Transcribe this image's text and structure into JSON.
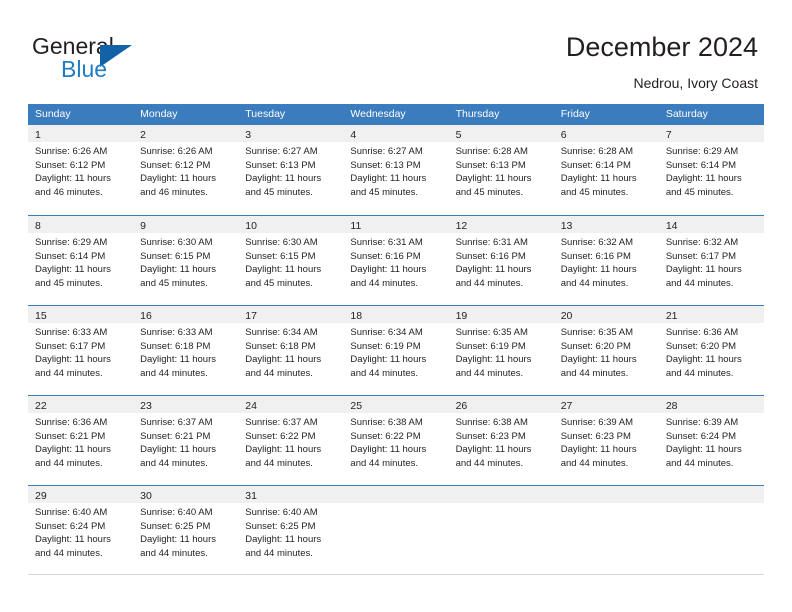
{
  "brand": {
    "line1": "General",
    "line2": "Blue",
    "icon": "triangle-flag-icon",
    "color_dark": "#231f20",
    "color_blue": "#1f7dc0",
    "flag_color": "#1362a8"
  },
  "header": {
    "title": "December 2024",
    "subtitle": "Nedrou, Ivory Coast"
  },
  "theme": {
    "header_bg": "#3b7cbe",
    "header_text": "#ffffff",
    "day_strip_bg": "#f0f0f0",
    "text": "#231f20"
  },
  "calendar": {
    "weekday_headers": [
      "Sunday",
      "Monday",
      "Tuesday",
      "Wednesday",
      "Thursday",
      "Friday",
      "Saturday"
    ],
    "weeks": [
      [
        {
          "day": "1",
          "sunrise": "Sunrise: 6:26 AM",
          "sunset": "Sunset: 6:12 PM",
          "daylight1": "Daylight: 11 hours",
          "daylight2": "and 46 minutes."
        },
        {
          "day": "2",
          "sunrise": "Sunrise: 6:26 AM",
          "sunset": "Sunset: 6:12 PM",
          "daylight1": "Daylight: 11 hours",
          "daylight2": "and 46 minutes."
        },
        {
          "day": "3",
          "sunrise": "Sunrise: 6:27 AM",
          "sunset": "Sunset: 6:13 PM",
          "daylight1": "Daylight: 11 hours",
          "daylight2": "and 45 minutes."
        },
        {
          "day": "4",
          "sunrise": "Sunrise: 6:27 AM",
          "sunset": "Sunset: 6:13 PM",
          "daylight1": "Daylight: 11 hours",
          "daylight2": "and 45 minutes."
        },
        {
          "day": "5",
          "sunrise": "Sunrise: 6:28 AM",
          "sunset": "Sunset: 6:13 PM",
          "daylight1": "Daylight: 11 hours",
          "daylight2": "and 45 minutes."
        },
        {
          "day": "6",
          "sunrise": "Sunrise: 6:28 AM",
          "sunset": "Sunset: 6:14 PM",
          "daylight1": "Daylight: 11 hours",
          "daylight2": "and 45 minutes."
        },
        {
          "day": "7",
          "sunrise": "Sunrise: 6:29 AM",
          "sunset": "Sunset: 6:14 PM",
          "daylight1": "Daylight: 11 hours",
          "daylight2": "and 45 minutes."
        }
      ],
      [
        {
          "day": "8",
          "sunrise": "Sunrise: 6:29 AM",
          "sunset": "Sunset: 6:14 PM",
          "daylight1": "Daylight: 11 hours",
          "daylight2": "and 45 minutes."
        },
        {
          "day": "9",
          "sunrise": "Sunrise: 6:30 AM",
          "sunset": "Sunset: 6:15 PM",
          "daylight1": "Daylight: 11 hours",
          "daylight2": "and 45 minutes."
        },
        {
          "day": "10",
          "sunrise": "Sunrise: 6:30 AM",
          "sunset": "Sunset: 6:15 PM",
          "daylight1": "Daylight: 11 hours",
          "daylight2": "and 45 minutes."
        },
        {
          "day": "11",
          "sunrise": "Sunrise: 6:31 AM",
          "sunset": "Sunset: 6:16 PM",
          "daylight1": "Daylight: 11 hours",
          "daylight2": "and 44 minutes."
        },
        {
          "day": "12",
          "sunrise": "Sunrise: 6:31 AM",
          "sunset": "Sunset: 6:16 PM",
          "daylight1": "Daylight: 11 hours",
          "daylight2": "and 44 minutes."
        },
        {
          "day": "13",
          "sunrise": "Sunrise: 6:32 AM",
          "sunset": "Sunset: 6:16 PM",
          "daylight1": "Daylight: 11 hours",
          "daylight2": "and 44 minutes."
        },
        {
          "day": "14",
          "sunrise": "Sunrise: 6:32 AM",
          "sunset": "Sunset: 6:17 PM",
          "daylight1": "Daylight: 11 hours",
          "daylight2": "and 44 minutes."
        }
      ],
      [
        {
          "day": "15",
          "sunrise": "Sunrise: 6:33 AM",
          "sunset": "Sunset: 6:17 PM",
          "daylight1": "Daylight: 11 hours",
          "daylight2": "and 44 minutes."
        },
        {
          "day": "16",
          "sunrise": "Sunrise: 6:33 AM",
          "sunset": "Sunset: 6:18 PM",
          "daylight1": "Daylight: 11 hours",
          "daylight2": "and 44 minutes."
        },
        {
          "day": "17",
          "sunrise": "Sunrise: 6:34 AM",
          "sunset": "Sunset: 6:18 PM",
          "daylight1": "Daylight: 11 hours",
          "daylight2": "and 44 minutes."
        },
        {
          "day": "18",
          "sunrise": "Sunrise: 6:34 AM",
          "sunset": "Sunset: 6:19 PM",
          "daylight1": "Daylight: 11 hours",
          "daylight2": "and 44 minutes."
        },
        {
          "day": "19",
          "sunrise": "Sunrise: 6:35 AM",
          "sunset": "Sunset: 6:19 PM",
          "daylight1": "Daylight: 11 hours",
          "daylight2": "and 44 minutes."
        },
        {
          "day": "20",
          "sunrise": "Sunrise: 6:35 AM",
          "sunset": "Sunset: 6:20 PM",
          "daylight1": "Daylight: 11 hours",
          "daylight2": "and 44 minutes."
        },
        {
          "day": "21",
          "sunrise": "Sunrise: 6:36 AM",
          "sunset": "Sunset: 6:20 PM",
          "daylight1": "Daylight: 11 hours",
          "daylight2": "and 44 minutes."
        }
      ],
      [
        {
          "day": "22",
          "sunrise": "Sunrise: 6:36 AM",
          "sunset": "Sunset: 6:21 PM",
          "daylight1": "Daylight: 11 hours",
          "daylight2": "and 44 minutes."
        },
        {
          "day": "23",
          "sunrise": "Sunrise: 6:37 AM",
          "sunset": "Sunset: 6:21 PM",
          "daylight1": "Daylight: 11 hours",
          "daylight2": "and 44 minutes."
        },
        {
          "day": "24",
          "sunrise": "Sunrise: 6:37 AM",
          "sunset": "Sunset: 6:22 PM",
          "daylight1": "Daylight: 11 hours",
          "daylight2": "and 44 minutes."
        },
        {
          "day": "25",
          "sunrise": "Sunrise: 6:38 AM",
          "sunset": "Sunset: 6:22 PM",
          "daylight1": "Daylight: 11 hours",
          "daylight2": "and 44 minutes."
        },
        {
          "day": "26",
          "sunrise": "Sunrise: 6:38 AM",
          "sunset": "Sunset: 6:23 PM",
          "daylight1": "Daylight: 11 hours",
          "daylight2": "and 44 minutes."
        },
        {
          "day": "27",
          "sunrise": "Sunrise: 6:39 AM",
          "sunset": "Sunset: 6:23 PM",
          "daylight1": "Daylight: 11 hours",
          "daylight2": "and 44 minutes."
        },
        {
          "day": "28",
          "sunrise": "Sunrise: 6:39 AM",
          "sunset": "Sunset: 6:24 PM",
          "daylight1": "Daylight: 11 hours",
          "daylight2": "and 44 minutes."
        }
      ],
      [
        {
          "day": "29",
          "sunrise": "Sunrise: 6:40 AM",
          "sunset": "Sunset: 6:24 PM",
          "daylight1": "Daylight: 11 hours",
          "daylight2": "and 44 minutes."
        },
        {
          "day": "30",
          "sunrise": "Sunrise: 6:40 AM",
          "sunset": "Sunset: 6:25 PM",
          "daylight1": "Daylight: 11 hours",
          "daylight2": "and 44 minutes."
        },
        {
          "day": "31",
          "sunrise": "Sunrise: 6:40 AM",
          "sunset": "Sunset: 6:25 PM",
          "daylight1": "Daylight: 11 hours",
          "daylight2": "and 44 minutes."
        },
        {
          "day": "",
          "sunrise": "",
          "sunset": "",
          "daylight1": "",
          "daylight2": ""
        },
        {
          "day": "",
          "sunrise": "",
          "sunset": "",
          "daylight1": "",
          "daylight2": ""
        },
        {
          "day": "",
          "sunrise": "",
          "sunset": "",
          "daylight1": "",
          "daylight2": ""
        },
        {
          "day": "",
          "sunrise": "",
          "sunset": "",
          "daylight1": "",
          "daylight2": ""
        }
      ]
    ]
  }
}
